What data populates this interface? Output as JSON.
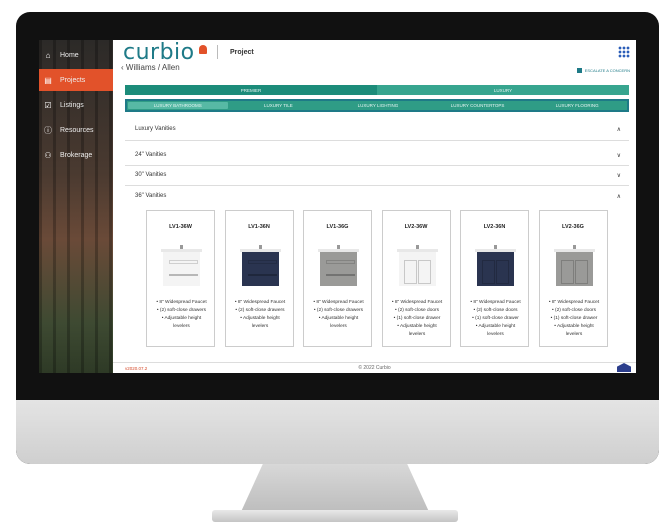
{
  "sidebar": {
    "items": [
      {
        "label": "Home",
        "icon": "home-icon",
        "glyph": "⌂"
      },
      {
        "label": "Projects",
        "icon": "clipboard-icon",
        "glyph": "▤"
      },
      {
        "label": "Listings",
        "icon": "check-square-icon",
        "glyph": "☑"
      },
      {
        "label": "Resources",
        "icon": "info-icon",
        "glyph": "ⓘ"
      },
      {
        "label": "Brokerage",
        "icon": "group-icon",
        "glyph": "⚇"
      }
    ],
    "active_color": "#e2522a"
  },
  "header": {
    "logo": "curbio",
    "page_title": "Project",
    "breadcrumb": "Williams / Allen",
    "export_label": "ESCALATE A CONCERN"
  },
  "tabs": {
    "top": [
      "PREMIER",
      "LUXURY"
    ],
    "sub": [
      "LUXURY BATHROOMS",
      "LUXURY TILE",
      "LUXURY LIGHTING",
      "LUXURY COUNTERTOPS",
      "LUXURY FLOORING"
    ],
    "selected_sub": "LUXURY BATHROOMS"
  },
  "sections": {
    "main": "Luxury Vanities",
    "groups": [
      "24\" Vanities",
      "30\" Vanities",
      "36\" Vanities"
    ]
  },
  "products": [
    {
      "code": "LV1-36W",
      "color": "#f4f4f4",
      "style": "drawers",
      "features": [
        "• 8\" Widespread Faucet",
        "• (2) soft-close drawers",
        "• Adjustable height",
        "levelers"
      ]
    },
    {
      "code": "LV1-36N",
      "color": "#2a3450",
      "style": "drawers",
      "features": [
        "• 8\" Widespread Faucet",
        "• (2) soft-close drawers",
        "• Adjustable height",
        "levelers"
      ]
    },
    {
      "code": "LV1-36G",
      "color": "#9a9a98",
      "style": "drawers",
      "features": [
        "• 8\" Widespread Faucet",
        "• (2) soft-close drawers",
        "• Adjustable height",
        "levelers"
      ]
    },
    {
      "code": "LV2-36W",
      "color": "#f4f4f4",
      "style": "doors",
      "features": [
        "• 8\" Widespread Faucet",
        "• (2) soft-close doors",
        "• (1) soft-close drawer",
        "• Adjustable height",
        "levelers"
      ]
    },
    {
      "code": "LV2-36N",
      "color": "#2a3450",
      "style": "doors",
      "features": [
        "• 8\" Widespread Faucet",
        "• (2) soft-close doors",
        "• (1) soft-close drawer",
        "• Adjustable height",
        "levelers"
      ]
    },
    {
      "code": "LV2-36G",
      "color": "#9a9a98",
      "style": "doors",
      "features": [
        "• 8\" Widespread Faucet",
        "• (2) soft-close doors",
        "• (1) soft-close drawer",
        "• Adjustable height",
        "levelers"
      ]
    }
  ],
  "footer": {
    "version": "v2020.07.2",
    "copyright": "© 2022 Curbio"
  }
}
